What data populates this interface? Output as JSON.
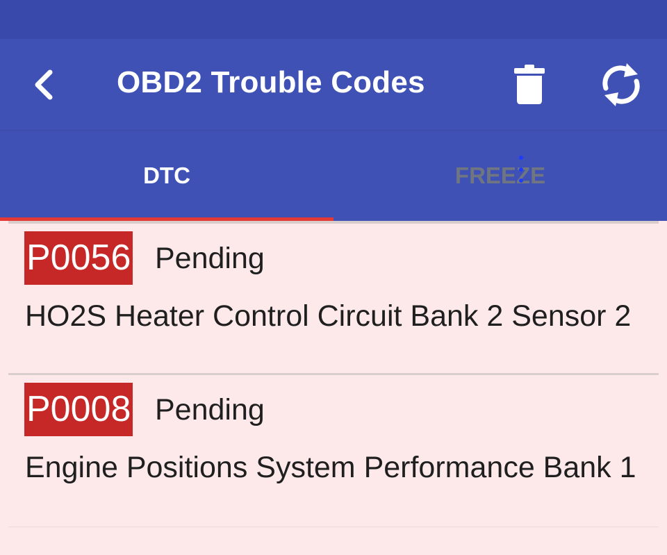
{
  "header": {
    "title": "OBD2 Trouble Codes",
    "back_icon": "back-chevron-icon",
    "delete_icon": "trash-icon",
    "refresh_icon": "refresh-icon"
  },
  "tabs": [
    {
      "label": "DTC",
      "selected": true
    },
    {
      "label": "FREEZE",
      "selected": false
    }
  ],
  "codes": [
    {
      "code": "P0056",
      "status": "Pending",
      "description": "HO2S Heater Control Circuit Bank 2 Sensor 2"
    },
    {
      "code": "P0008",
      "status": "Pending",
      "description": "Engine Positions System Performance Bank 1"
    }
  ],
  "colors": {
    "app_bar": "#3f51b5",
    "status_bar": "#3949ab",
    "tab_indicator": "#e53935",
    "code_badge": "#c62828",
    "list_background": "#fde8ea",
    "inactive_tab_text": "#6f7682"
  }
}
